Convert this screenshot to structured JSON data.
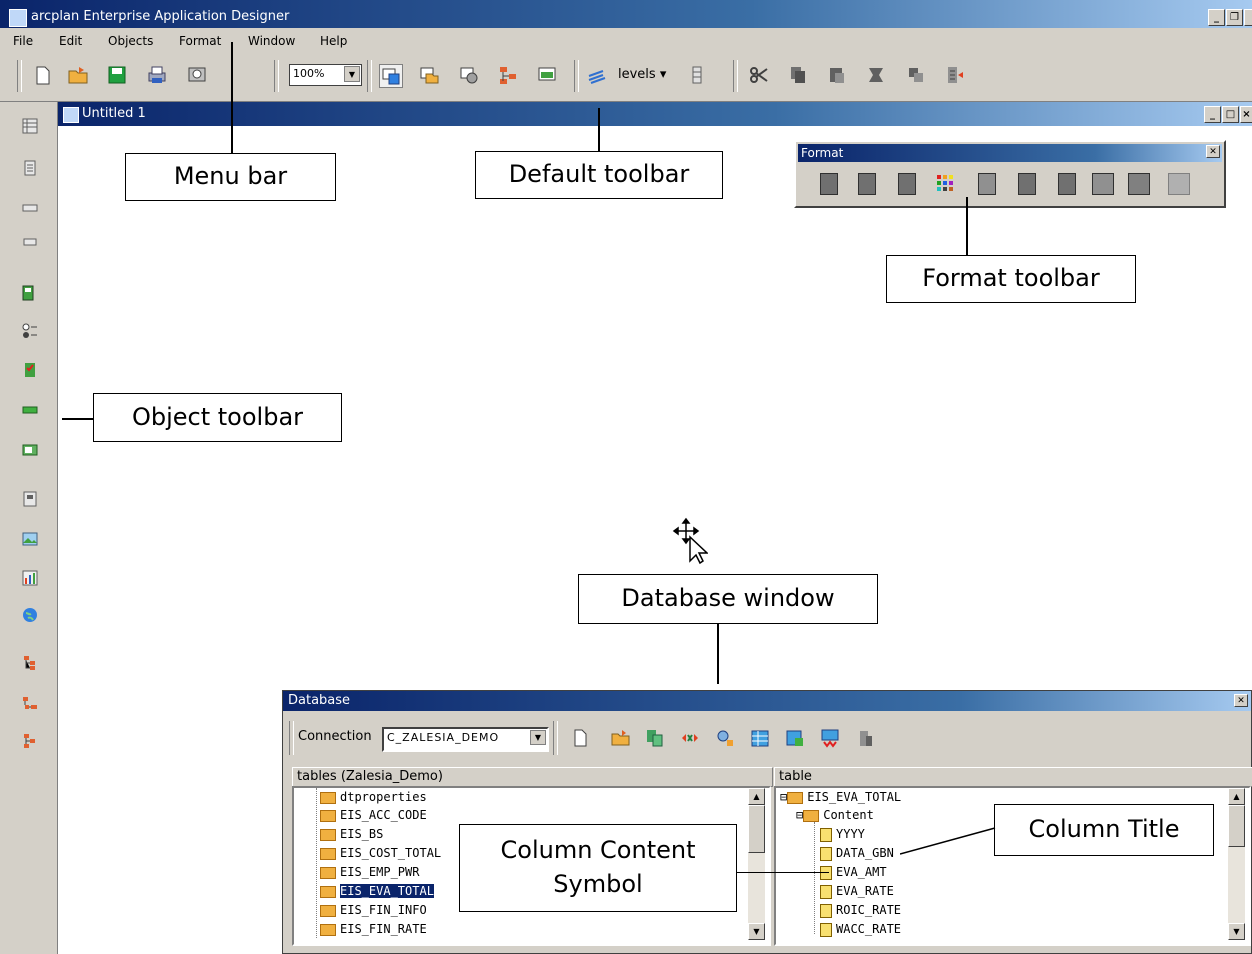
{
  "app": {
    "title": "arcplan Enterprise Application Designer"
  },
  "menu": [
    "File",
    "Edit",
    "Objects",
    "Format",
    "Window",
    "Help"
  ],
  "toolbar": {
    "zoom": "100%",
    "levels_label": "levels"
  },
  "document": {
    "title": "Untitled 1"
  },
  "format_toolbar": {
    "title": "Format"
  },
  "callouts": {
    "menu_bar": "Menu bar",
    "default_toolbar": "Default toolbar",
    "format_toolbar": "Format toolbar",
    "object_toolbar": "Object toolbar",
    "database_window": "Database window",
    "column_content_symbol": "Column Content Symbol",
    "column_title": "Column Title"
  },
  "database": {
    "title": "Database",
    "connection_label": "Connection",
    "connection_value": "C_ZALESIA_DEMO",
    "left_pane_header": "tables (Zalesia_Demo)",
    "right_pane_header": "table",
    "tables": [
      "dtproperties",
      "EIS_ACC_CODE",
      "EIS_BS",
      "EIS_COST_TOTAL",
      "EIS_EMP_PWR",
      "EIS_EVA_TOTAL",
      "EIS_FIN_INFO",
      "EIS_FIN_RATE"
    ],
    "selected_table": "EIS_EVA_TOTAL",
    "table_root": "EIS_EVA_TOTAL",
    "content_node": "Content",
    "columns": [
      "YYYY",
      "DATA_GBN",
      "EVA_AMT",
      "EVA_RATE",
      "ROIC_RATE",
      "WACC_RATE"
    ]
  }
}
